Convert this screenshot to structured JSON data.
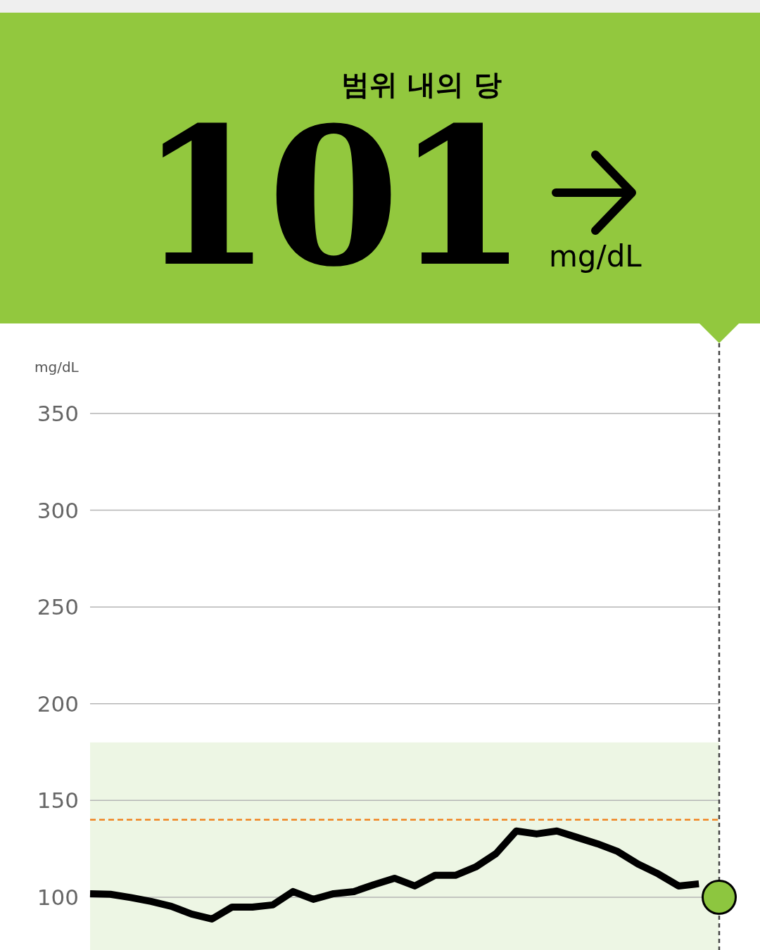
{
  "header": {
    "status": "범위 내의 당",
    "value": "101",
    "unit": "mg/dL"
  },
  "chart": {
    "unit_label": "mg/dL",
    "chart_data": {
      "type": "line",
      "categories": [
        null,
        null,
        null,
        null,
        null,
        null,
        null,
        null,
        null,
        null,
        null,
        null,
        null,
        null,
        null,
        null,
        null,
        null,
        null,
        null,
        null,
        null,
        null,
        null,
        null,
        null,
        null,
        null,
        null,
        null,
        null,
        null
      ],
      "ylim": [
        72.7,
        350
      ],
      "yticks": [
        100,
        150,
        200,
        250,
        300,
        350
      ],
      "grid": true,
      "bands": [
        {
          "axis": "y",
          "from": 70,
          "to": 180
        }
      ],
      "ref_lines": [
        {
          "axis": "y",
          "value": 140
        }
      ],
      "series": [
        {
          "color": "#000000",
          "values": [
            101.8,
            101.5,
            99.8,
            97.8,
            95.3,
            91.3,
            88.7,
            94.9,
            94.9,
            96,
            102.9,
            98.9,
            101.8,
            102.9,
            106.5,
            109.8,
            105.8,
            111.3,
            111.3,
            115.6,
            122.5,
            134.2,
            132.7,
            134.2,
            130.9,
            127.6,
            123.6,
            117.1,
            112,
            105.8,
            106.9,
            null
          ]
        }
      ]
    }
  }
}
